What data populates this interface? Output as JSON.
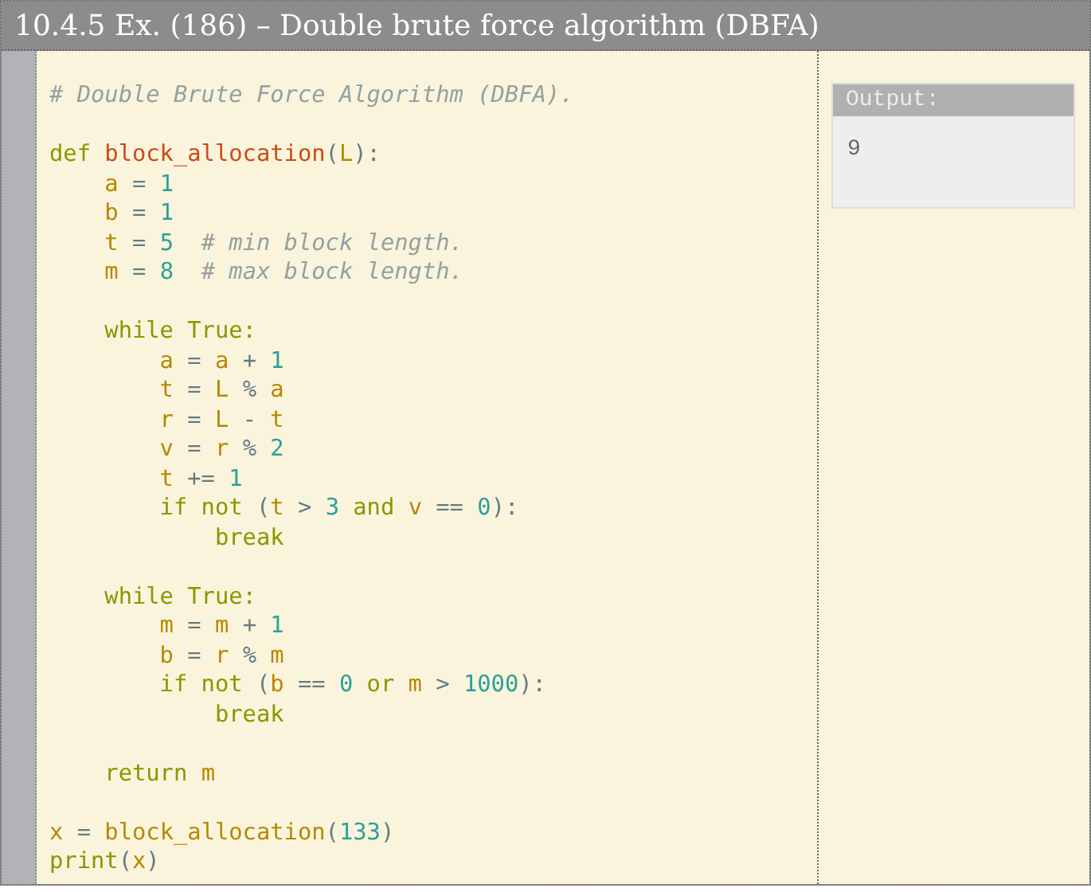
{
  "title": "10.4.5 Ex. (186) – Double brute force algorithm (DBFA)",
  "code": [
    {
      "kind": "code",
      "tokens": [
        {
          "kind": "comment",
          "text": "# Double Brute Force Algorithm (DBFA)."
        }
      ]
    },
    {
      "kind": "blank"
    },
    {
      "kind": "code",
      "tokens": [
        {
          "kind": "keyword",
          "text": "def "
        },
        {
          "kind": "function",
          "text": "block_allocation"
        },
        {
          "kind": "operator",
          "text": "("
        },
        {
          "kind": "variable",
          "text": "L"
        },
        {
          "kind": "operator",
          "text": "):"
        }
      ]
    },
    {
      "kind": "code",
      "tokens": [
        {
          "kind": "variable",
          "text": "    a"
        },
        {
          "kind": "operator",
          "text": " = "
        },
        {
          "kind": "number",
          "text": "1"
        }
      ]
    },
    {
      "kind": "code",
      "tokens": [
        {
          "kind": "variable",
          "text": "    b"
        },
        {
          "kind": "operator",
          "text": " = "
        },
        {
          "kind": "number",
          "text": "1"
        }
      ]
    },
    {
      "kind": "code",
      "tokens": [
        {
          "kind": "variable",
          "text": "    t"
        },
        {
          "kind": "operator",
          "text": " = "
        },
        {
          "kind": "number",
          "text": "5"
        },
        {
          "kind": "comment",
          "text": "  # min block length."
        }
      ]
    },
    {
      "kind": "code",
      "tokens": [
        {
          "kind": "variable",
          "text": "    m"
        },
        {
          "kind": "operator",
          "text": " = "
        },
        {
          "kind": "number",
          "text": "8"
        },
        {
          "kind": "comment",
          "text": "  # max block length."
        }
      ]
    },
    {
      "kind": "blank"
    },
    {
      "kind": "code",
      "tokens": [
        {
          "kind": "keyword",
          "text": "    while True:"
        }
      ]
    },
    {
      "kind": "code",
      "tokens": [
        {
          "kind": "variable",
          "text": "        a"
        },
        {
          "kind": "operator",
          "text": " = "
        },
        {
          "kind": "variable",
          "text": "a"
        },
        {
          "kind": "operator",
          "text": " + "
        },
        {
          "kind": "number",
          "text": "1"
        }
      ]
    },
    {
      "kind": "code",
      "tokens": [
        {
          "kind": "variable",
          "text": "        t"
        },
        {
          "kind": "operator",
          "text": " = "
        },
        {
          "kind": "variable",
          "text": "L"
        },
        {
          "kind": "operator",
          "text": " % "
        },
        {
          "kind": "variable",
          "text": "a"
        }
      ]
    },
    {
      "kind": "code",
      "tokens": [
        {
          "kind": "variable",
          "text": "        r"
        },
        {
          "kind": "operator",
          "text": " = "
        },
        {
          "kind": "variable",
          "text": "L"
        },
        {
          "kind": "operator",
          "text": " - "
        },
        {
          "kind": "variable",
          "text": "t"
        }
      ]
    },
    {
      "kind": "code",
      "tokens": [
        {
          "kind": "variable",
          "text": "        v"
        },
        {
          "kind": "operator",
          "text": " = "
        },
        {
          "kind": "variable",
          "text": "r"
        },
        {
          "kind": "operator",
          "text": " % "
        },
        {
          "kind": "number",
          "text": "2"
        }
      ]
    },
    {
      "kind": "code",
      "tokens": [
        {
          "kind": "variable",
          "text": "        t"
        },
        {
          "kind": "operator",
          "text": " += "
        },
        {
          "kind": "number",
          "text": "1"
        }
      ]
    },
    {
      "kind": "code",
      "tokens": [
        {
          "kind": "keyword",
          "text": "        if not "
        },
        {
          "kind": "operator",
          "text": "("
        },
        {
          "kind": "variable",
          "text": "t"
        },
        {
          "kind": "operator",
          "text": " > "
        },
        {
          "kind": "number",
          "text": "3"
        },
        {
          "kind": "keyword",
          "text": " and "
        },
        {
          "kind": "variable",
          "text": "v"
        },
        {
          "kind": "operator",
          "text": " == "
        },
        {
          "kind": "number",
          "text": "0"
        },
        {
          "kind": "operator",
          "text": "):"
        }
      ]
    },
    {
      "kind": "code",
      "tokens": [
        {
          "kind": "keyword",
          "text": "            break"
        }
      ]
    },
    {
      "kind": "blank"
    },
    {
      "kind": "code",
      "tokens": [
        {
          "kind": "keyword",
          "text": "    while True:"
        }
      ]
    },
    {
      "kind": "code",
      "tokens": [
        {
          "kind": "variable",
          "text": "        m"
        },
        {
          "kind": "operator",
          "text": " = "
        },
        {
          "kind": "variable",
          "text": "m"
        },
        {
          "kind": "operator",
          "text": " + "
        },
        {
          "kind": "number",
          "text": "1"
        }
      ]
    },
    {
      "kind": "code",
      "tokens": [
        {
          "kind": "variable",
          "text": "        b"
        },
        {
          "kind": "operator",
          "text": " = "
        },
        {
          "kind": "variable",
          "text": "r"
        },
        {
          "kind": "operator",
          "text": " % "
        },
        {
          "kind": "variable",
          "text": "m"
        }
      ]
    },
    {
      "kind": "code",
      "tokens": [
        {
          "kind": "keyword",
          "text": "        if not "
        },
        {
          "kind": "operator",
          "text": "("
        },
        {
          "kind": "variable",
          "text": "b"
        },
        {
          "kind": "operator",
          "text": " == "
        },
        {
          "kind": "number",
          "text": "0"
        },
        {
          "kind": "keyword",
          "text": " or "
        },
        {
          "kind": "variable",
          "text": "m"
        },
        {
          "kind": "operator",
          "text": " > "
        },
        {
          "kind": "number",
          "text": "1000"
        },
        {
          "kind": "operator",
          "text": "):"
        }
      ]
    },
    {
      "kind": "code",
      "tokens": [
        {
          "kind": "keyword",
          "text": "            break"
        }
      ]
    },
    {
      "kind": "blank"
    },
    {
      "kind": "code",
      "tokens": [
        {
          "kind": "keyword",
          "text": "    return "
        },
        {
          "kind": "variable",
          "text": "m"
        }
      ]
    },
    {
      "kind": "blank"
    },
    {
      "kind": "code",
      "tokens": [
        {
          "kind": "variable",
          "text": "x"
        },
        {
          "kind": "operator",
          "text": " = "
        },
        {
          "kind": "variable",
          "text": "block_allocation"
        },
        {
          "kind": "operator",
          "text": "("
        },
        {
          "kind": "number",
          "text": "133"
        },
        {
          "kind": "operator",
          "text": ")"
        }
      ]
    },
    {
      "kind": "code",
      "tokens": [
        {
          "kind": "keyword",
          "text": "print"
        },
        {
          "kind": "operator",
          "text": "("
        },
        {
          "kind": "variable",
          "text": "x"
        },
        {
          "kind": "operator",
          "text": ")"
        }
      ]
    }
  ],
  "output": {
    "label": "Output:",
    "value": "9"
  }
}
